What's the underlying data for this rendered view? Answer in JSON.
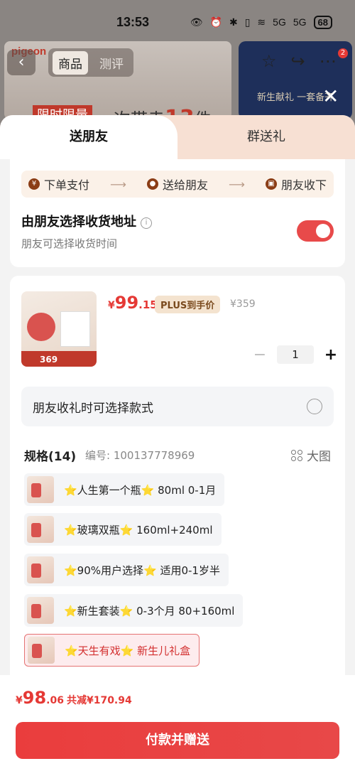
{
  "status_bar": {
    "time": "13:53",
    "signal1": "5G",
    "signal2": "5G",
    "battery": "68"
  },
  "background": {
    "brand": "pigeon",
    "tabs": [
      "商品",
      "测评"
    ],
    "banner_limit": "限时限量",
    "banner_slogan_prefix": "一次带走",
    "banner_slogan_num": "13",
    "banner_slogan_suffix": "件",
    "right_banner_text": "新生献礼 一套备齐",
    "cart_badge": "2"
  },
  "sheet": {
    "tabs": [
      {
        "label": "送朋友",
        "active": true
      },
      {
        "label": "群送礼",
        "active": false
      }
    ],
    "flow": {
      "step1": "下单支付",
      "step2": "送给朋友",
      "step3": "朋友收下",
      "step1_icon": "¥"
    },
    "address": {
      "title": "由朋友选择收货地址",
      "subtitle": "朋友可选择收货时间",
      "toggle_on": true
    },
    "product": {
      "price_symbol": "¥",
      "price_int": "99",
      "price_dec": ".15",
      "plus_tag": "PLUS到手价",
      "original_price": "¥359",
      "image_price": "369",
      "quantity": "1",
      "style_choose_label": "朋友收礼时可选择款式",
      "spec_title": "规格(14)",
      "spec_no": "编号: 100137778969",
      "big_image": "大图",
      "specs": [
        {
          "label": "⭐人生第一个瓶⭐ 80ml 0-1月",
          "selected": false
        },
        {
          "label": "⭐玻璃双瓶⭐   160ml+240ml",
          "selected": false
        },
        {
          "label": "⭐90%用户选择⭐   适用0-1岁半",
          "selected": false
        },
        {
          "label": "⭐新生套装⭐  0-3个月 80+160ml",
          "selected": false
        },
        {
          "label": "⭐天生有戏⭐   新生儿礼盒",
          "selected": true
        }
      ]
    }
  },
  "footer": {
    "total_symbol": "¥",
    "total_int": "98",
    "total_dec": ".06",
    "saved": "共减¥170.94",
    "pay_button": "付款并赠送"
  }
}
